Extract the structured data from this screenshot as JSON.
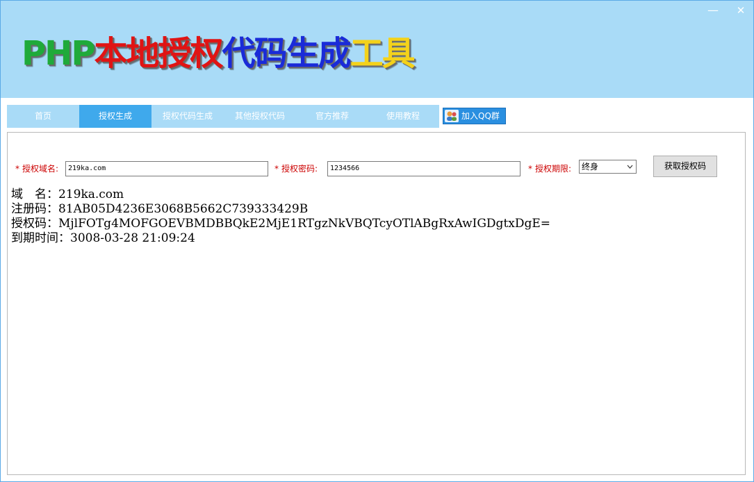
{
  "window": {
    "minimize": "—",
    "close": "✕"
  },
  "logo": {
    "part1": "PHP",
    "part2": "本地授权",
    "part3": "代码生成",
    "part4": "工具"
  },
  "nav": {
    "items": [
      "首页",
      "授权生成",
      "授权代码生成",
      "其他授权代码",
      "官方推荐",
      "使用教程"
    ],
    "active_index": 1
  },
  "qq_button": {
    "label": "加入QQ群",
    "icon": "qq-group-icon"
  },
  "form": {
    "domain_label": "授权域名:",
    "domain_value": "219ka.com",
    "password_label": "授权密码:",
    "password_value": "1234566",
    "period_label": "授权期限:",
    "period_value": "终身",
    "submit_label": "获取授权码",
    "required_marker": "*"
  },
  "result": {
    "domain_label": "域　名：",
    "domain_value": "219ka.com",
    "regcode_label": "注册码：",
    "regcode_value": "81AB05D4236E3068B5662C739333429B",
    "authcode_label": "授权码：",
    "authcode_value": "MjlFOTg4MOFGOEVBMDBBQkE2MjE1RTgzNkVBQTcyOTlABgRxAwIGDgtxDgE=",
    "expiry_label": "到期时间：",
    "expiry_value": "3008-03-28 21:09:24"
  },
  "colors": {
    "header_bg": "#a9dbf7",
    "nav_active": "#3fa9ec",
    "label_red": "#cc0000"
  }
}
